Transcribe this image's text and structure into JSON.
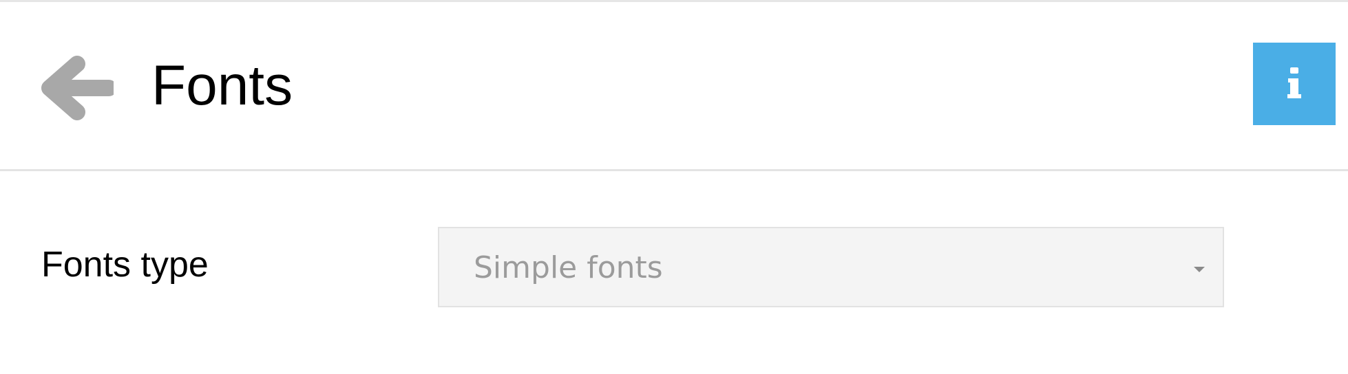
{
  "header": {
    "title": "Fonts",
    "back_icon": "arrow-left-icon",
    "info_icon": "info-icon",
    "info_color": "#4aaee6"
  },
  "settings": {
    "fonts_type": {
      "label": "Fonts type",
      "selected": "Simple fonts"
    }
  }
}
